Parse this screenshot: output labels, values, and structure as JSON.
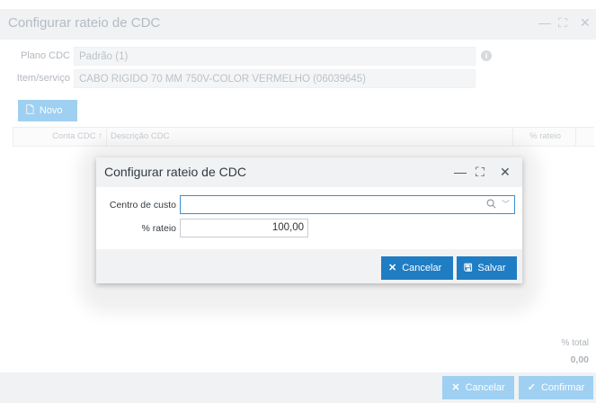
{
  "background_window": {
    "title": "Configurar rateio de CDC",
    "controls": {
      "minimize": "—",
      "maximize": "⛶",
      "close": "✕"
    },
    "fields": {
      "plano_cdc_label": "Plano CDC",
      "plano_cdc_value": "Padrão (1)",
      "item_servico_label": "Item/serviço",
      "item_servico_value": "CABO RIGIDO 70 MM  750V-COLOR  VERMELHO (06039645)"
    },
    "novo_button": "Novo",
    "grid_columns": [
      "Conta CDC",
      "Descrição CDC",
      "% rateio"
    ],
    "sort_indicator": "↑",
    "total_label": "% total",
    "total_value": "0,00",
    "cancel_button": "Cancelar",
    "confirm_button": "Confirmar"
  },
  "modal": {
    "title": "Configurar rateio de CDC",
    "controls": {
      "minimize": "—",
      "maximize": "⛶",
      "close": "✕"
    },
    "centro_custo_label": "Centro de custo",
    "centro_custo_value": "",
    "rateio_label": "% rateio",
    "rateio_value": "100,00",
    "cancel_button": "Cancelar",
    "save_button": "Salvar"
  },
  "colors": {
    "primary": "#1f7dc4",
    "primary_disabled": "#9fd0f2",
    "focus_border": "#3c8ed0",
    "titlebar": "#f0f2f4"
  }
}
